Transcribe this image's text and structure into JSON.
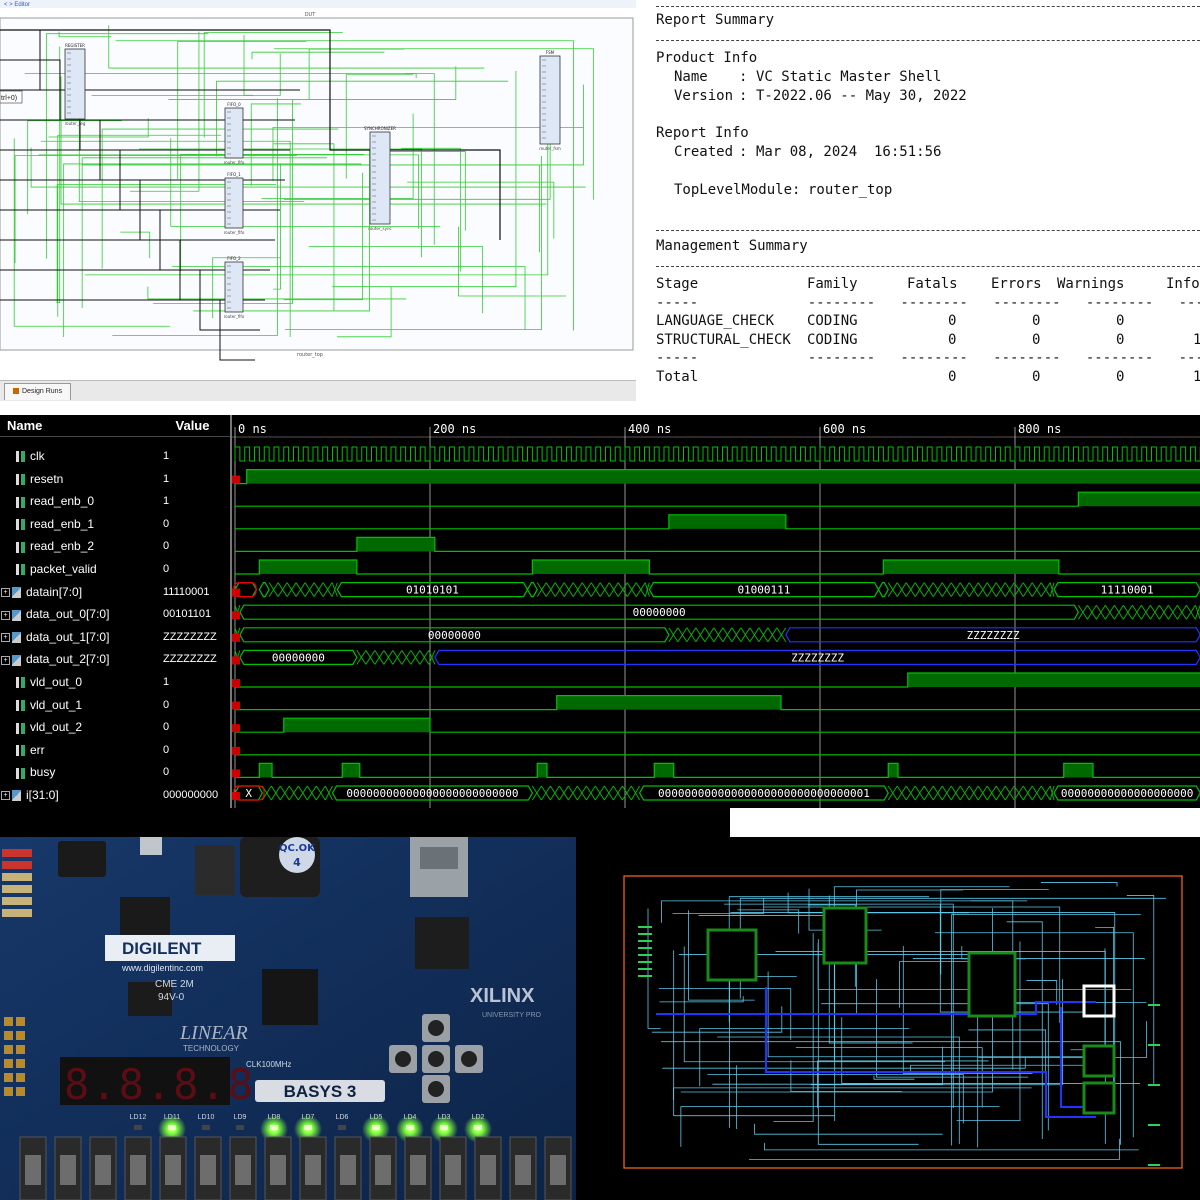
{
  "schematic": {
    "top_label": "DUT",
    "bottom_label": "router_top",
    "left_label": "trl+0)",
    "corner_link": "< > Editor",
    "blocks": [
      {
        "title": "REGISTER",
        "sub": "router_reg"
      },
      {
        "title": "FSM",
        "sub": "router_fsm"
      },
      {
        "title": "FIFO_0",
        "sub": "router_fifo"
      },
      {
        "title": "SYNCHRONIZER",
        "sub": "router_sync"
      },
      {
        "title": "FIFO_1",
        "sub": "router_fifo"
      },
      {
        "title": "FIFO_2",
        "sub": "router_fifo"
      }
    ],
    "tab_label": "Design Runs",
    "wire_color": "#33cc33"
  },
  "report": {
    "summary_title": "Report Summary",
    "product_info_title": "Product Info",
    "product_name_label": "Name",
    "product_name": "VC Static Master Shell",
    "product_version_label": "Version",
    "product_version": "T-2022.06 -- May 30, 2022",
    "report_info_title": "Report Info",
    "created_label": "Created",
    "created_value": "Mar 08, 2024  16:51:56",
    "top_module_label": "TopLevelModule:",
    "top_module_value": "router_top",
    "mgmt_title": "Management Summary",
    "columns": [
      "Stage",
      "Family",
      "Fatals",
      "Errors",
      "Warnings",
      "Info"
    ],
    "rows": [
      {
        "stage": "LANGUAGE_CHECK",
        "family": "CODING",
        "fatals": "0",
        "errors": "0",
        "warnings": "0",
        "info": ""
      },
      {
        "stage": "STRUCTURAL_CHECK",
        "family": "CODING",
        "fatals": "0",
        "errors": "0",
        "warnings": "0",
        "info": "1"
      }
    ],
    "total_label": "Total",
    "total": {
      "fatals": "0",
      "errors": "0",
      "warnings": "0",
      "info": "1"
    }
  },
  "waveform": {
    "name_header": "Name",
    "value_header": "Value",
    "time_labels": [
      "0 ns",
      "200 ns",
      "400 ns",
      "600 ns",
      "800 ns"
    ],
    "signals": [
      {
        "name": "clk",
        "value": "1",
        "type": "bit"
      },
      {
        "name": "resetn",
        "value": "1",
        "type": "bit"
      },
      {
        "name": "read_enb_0",
        "value": "1",
        "type": "bit"
      },
      {
        "name": "read_enb_1",
        "value": "0",
        "type": "bit"
      },
      {
        "name": "read_enb_2",
        "value": "0",
        "type": "bit"
      },
      {
        "name": "packet_valid",
        "value": "0",
        "type": "bit"
      },
      {
        "name": "datain[7:0]",
        "value": "11110001",
        "type": "bus"
      },
      {
        "name": "data_out_0[7:0]",
        "value": "00101101",
        "type": "bus"
      },
      {
        "name": "data_out_1[7:0]",
        "value": "ZZZZZZZZ",
        "type": "bus"
      },
      {
        "name": "data_out_2[7:0]",
        "value": "ZZZZZZZZ",
        "type": "bus"
      },
      {
        "name": "vld_out_0",
        "value": "1",
        "type": "bit"
      },
      {
        "name": "vld_out_1",
        "value": "0",
        "type": "bit"
      },
      {
        "name": "vld_out_2",
        "value": "0",
        "type": "bit"
      },
      {
        "name": "err",
        "value": "0",
        "type": "bit"
      },
      {
        "name": "busy",
        "value": "0",
        "type": "bit"
      },
      {
        "name": "i[31:0]",
        "value": "000000000",
        "type": "bus"
      }
    ],
    "bus_labels": {
      "datain": [
        "01010101",
        "01000111",
        "11110001"
      ],
      "data_out_0": [
        "00000000"
      ],
      "data_out_1": [
        "00000000",
        "ZZZZZZZZ"
      ],
      "data_out_2": [
        "00000000",
        "ZZZZZZZZ"
      ],
      "i": [
        "X",
        "00000000000000000000000000",
        "00000000000000000000000000000001",
        "00000000000000000000"
      ]
    },
    "trace_color": "#00c000",
    "z_color": "#2233ff"
  },
  "board": {
    "brand": "DIGILENT",
    "url": "www.digilentinc.com",
    "vendor": "XILINX",
    "vendor_sub": "UNIVERSITY PRO",
    "board_name": "BASYS 3",
    "qc_label": "QC.OK",
    "qc_num": "4",
    "chip_brand": "LINEAR",
    "chip_sub": "TECHNOLOGY",
    "cert": "CME 2M",
    "rating": "94V-0",
    "seven_seg": "8.8.8.8.",
    "clock_label": "CLK100MHz",
    "led_labels": [
      "LD12",
      "LD11",
      "LD10",
      "LD9",
      "LD8",
      "LD7",
      "LD6",
      "LD5",
      "LD4",
      "LD3",
      "LD2"
    ],
    "led_lit": [
      false,
      true,
      false,
      false,
      true,
      true,
      false,
      true,
      true,
      true,
      true
    ]
  },
  "layout": {
    "frame_color": "#ff6a1a",
    "wire_color": "#5bc8e8",
    "bus_color": "#2233ff",
    "block_color": "#1a8a1a"
  }
}
